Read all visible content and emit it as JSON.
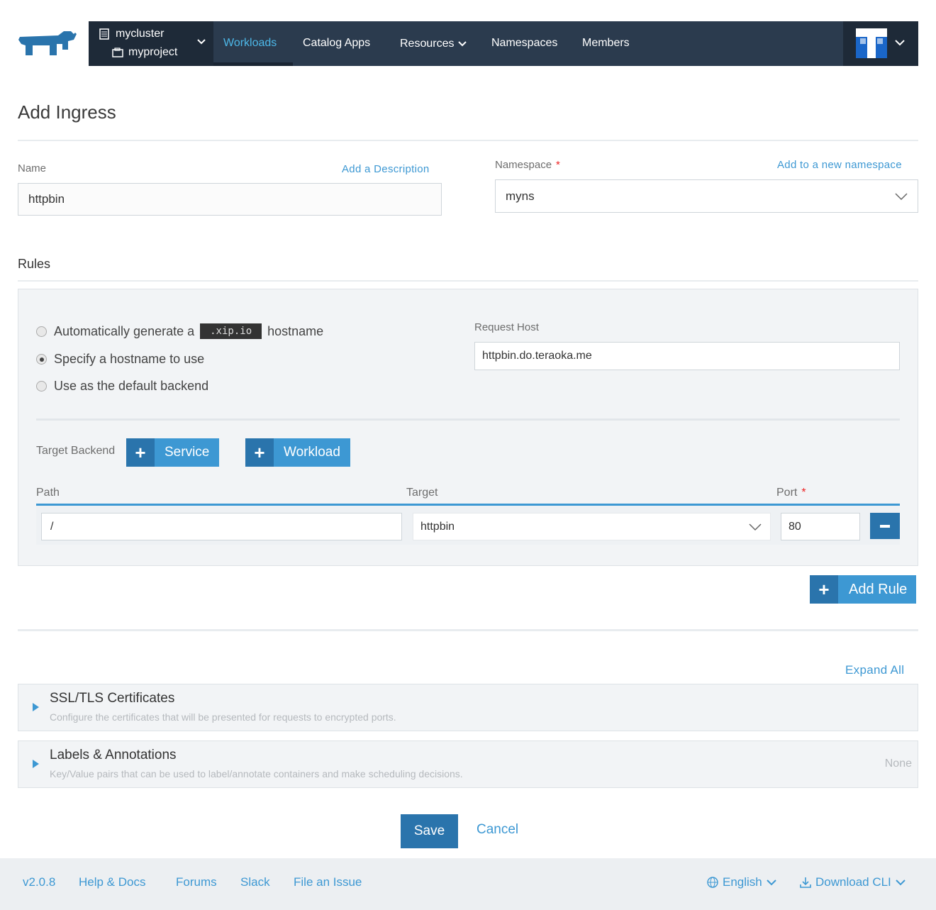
{
  "header": {
    "cluster": "mycluster",
    "project": "myproject",
    "nav": [
      "Workloads",
      "Catalog Apps",
      "Resources",
      "Namespaces",
      "Members"
    ]
  },
  "page": {
    "title": "Add Ingress"
  },
  "form": {
    "name_label": "Name",
    "add_description": "Add a Description",
    "name_value": "httpbin",
    "namespace_label": "Namespace",
    "namespace_required": "*",
    "add_namespace": "Add to a new namespace",
    "namespace_value": "myns"
  },
  "rules": {
    "title": "Rules",
    "radio_auto_prefix": "Automatically generate a",
    "radio_auto_code": ".xip.io",
    "radio_auto_suffix": "hostname",
    "radio_specify": "Specify a hostname to use",
    "radio_default": "Use as the default backend",
    "selected": "specify",
    "request_host_label": "Request Host",
    "request_host_value": "httpbin.do.teraoka.me",
    "target_backend_label": "Target Backend",
    "service_button": "Service",
    "workload_button": "Workload",
    "col_path": "Path",
    "col_target": "Target",
    "col_port": "Port",
    "port_required": "*",
    "row": {
      "path": "/",
      "target": "httpbin",
      "port": "80"
    },
    "add_rule_button": "Add Rule"
  },
  "sections": {
    "expand_all": "Expand All",
    "ssl_title": "SSL/TLS Certificates",
    "ssl_desc": "Configure the certificates that will be presented for requests to encrypted ports.",
    "labels_title": "Labels & Annotations",
    "labels_desc": "Key/Value pairs that can be used to label/annotate containers and make scheduling decisions.",
    "labels_status": "None"
  },
  "actions": {
    "save": "Save",
    "cancel": "Cancel"
  },
  "footer": {
    "version": "v2.0.8",
    "links": [
      "Help & Docs",
      "Forums",
      "Slack",
      "File an Issue"
    ],
    "language": "English",
    "download": "Download CLI"
  },
  "colors": {
    "accent": "#3d98d3",
    "dark_blue": "#2a74ac",
    "nav_bg": "#2b3b4e"
  }
}
